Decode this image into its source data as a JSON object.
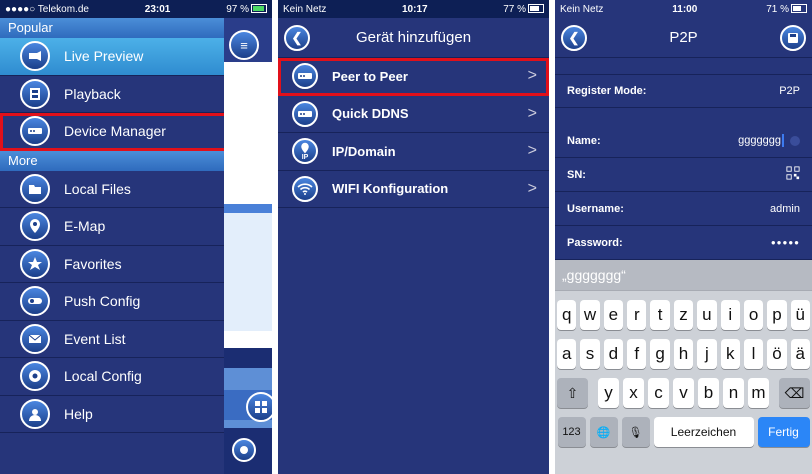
{
  "panel1": {
    "status": {
      "carrier": "●●●●○ Telekom.de",
      "time": "23:01",
      "battery": "97 %"
    },
    "sections": [
      {
        "header": "Popular",
        "items": [
          {
            "label": "Live Preview",
            "icon": "camera-icon",
            "active": true
          },
          {
            "label": "Playback",
            "icon": "film-icon"
          },
          {
            "label": "Device Manager",
            "icon": "device-icon",
            "highlighted": true
          }
        ]
      },
      {
        "header": "More",
        "items": [
          {
            "label": "Local Files",
            "icon": "folder-icon"
          },
          {
            "label": "E-Map",
            "icon": "map-pin-icon"
          },
          {
            "label": "Favorites",
            "icon": "star-icon"
          },
          {
            "label": "Push Config",
            "icon": "toggle-icon"
          },
          {
            "label": "Event List",
            "icon": "envelope-icon"
          },
          {
            "label": "Local Config",
            "icon": "gear-icon"
          },
          {
            "label": "Help",
            "icon": "user-help-icon"
          }
        ]
      }
    ]
  },
  "panel2": {
    "status": {
      "carrier": "Kein Netz",
      "time": "10:17",
      "battery": "77 %"
    },
    "title": "Gerät hinzufügen",
    "items": [
      {
        "label": "Peer to Peer",
        "icon": "device-icon",
        "highlighted": true
      },
      {
        "label": "Quick DDNS",
        "icon": "device-icon"
      },
      {
        "label": "IP/Domain",
        "icon": "ip-pin-icon",
        "badge": "IP"
      },
      {
        "label": "WIFI Konfiguration",
        "icon": "wifi-icon"
      }
    ],
    "chevron": ">"
  },
  "panel3": {
    "status": {
      "carrier": "Kein Netz",
      "time": "11:00",
      "battery": "71 %"
    },
    "title": "P2P",
    "form": {
      "register_mode_label": "Register Mode:",
      "register_mode_value": "P2P",
      "name_label": "Name:",
      "name_value": "ggggggg",
      "sn_label": "SN:",
      "username_label": "Username:",
      "username_value": "admin",
      "password_label": "Password:",
      "password_value": "●●●●●"
    },
    "keyboard": {
      "suggestion": "„ggggggg“",
      "row1": [
        "q",
        "w",
        "e",
        "r",
        "t",
        "z",
        "u",
        "i",
        "o",
        "p",
        "ü"
      ],
      "row2": [
        "a",
        "s",
        "d",
        "f",
        "g",
        "h",
        "j",
        "k",
        "l",
        "ö",
        "ä"
      ],
      "row3": [
        "y",
        "x",
        "c",
        "v",
        "b",
        "n",
        "m"
      ],
      "shift": "⇧",
      "delete": "⌫",
      "numbers": "123",
      "globe": "🌐",
      "mic": "🎙",
      "space": "Leerzeichen",
      "done": "Fertig"
    }
  }
}
